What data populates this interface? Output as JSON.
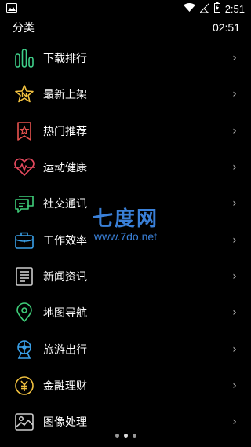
{
  "status": {
    "time": "2:51"
  },
  "header": {
    "title": "分类",
    "time": "02:51"
  },
  "categories": [
    {
      "label": "下载排行",
      "icon": "bar-chart-icon",
      "color": "#3fd08a"
    },
    {
      "label": "最新上架",
      "icon": "star-new-icon",
      "color": "#f2c240"
    },
    {
      "label": "热门推荐",
      "icon": "hot-tag-icon",
      "color": "#e8534f"
    },
    {
      "label": "运动健康",
      "icon": "heartbeat-icon",
      "color": "#e84a5f"
    },
    {
      "label": "社交通讯",
      "icon": "chat-icon",
      "color": "#3fcf7a"
    },
    {
      "label": "工作效率",
      "icon": "briefcase-icon",
      "color": "#3aa0e8"
    },
    {
      "label": "新闻资讯",
      "icon": "newspaper-icon",
      "color": "#cccccc"
    },
    {
      "label": "地图导航",
      "icon": "map-pin-icon",
      "color": "#3fcf7a"
    },
    {
      "label": "旅游出行",
      "icon": "ferris-wheel-icon",
      "color": "#3aa0e8"
    },
    {
      "label": "金融理财",
      "icon": "yuan-coin-icon",
      "color": "#f2c240"
    },
    {
      "label": "图像处理",
      "icon": "image-icon",
      "color": "#cccccc"
    }
  ],
  "chevron": "›",
  "watermark": {
    "main": "七度网",
    "sub": "www.7do.net"
  },
  "pager": {
    "count": 3,
    "active": 1
  }
}
